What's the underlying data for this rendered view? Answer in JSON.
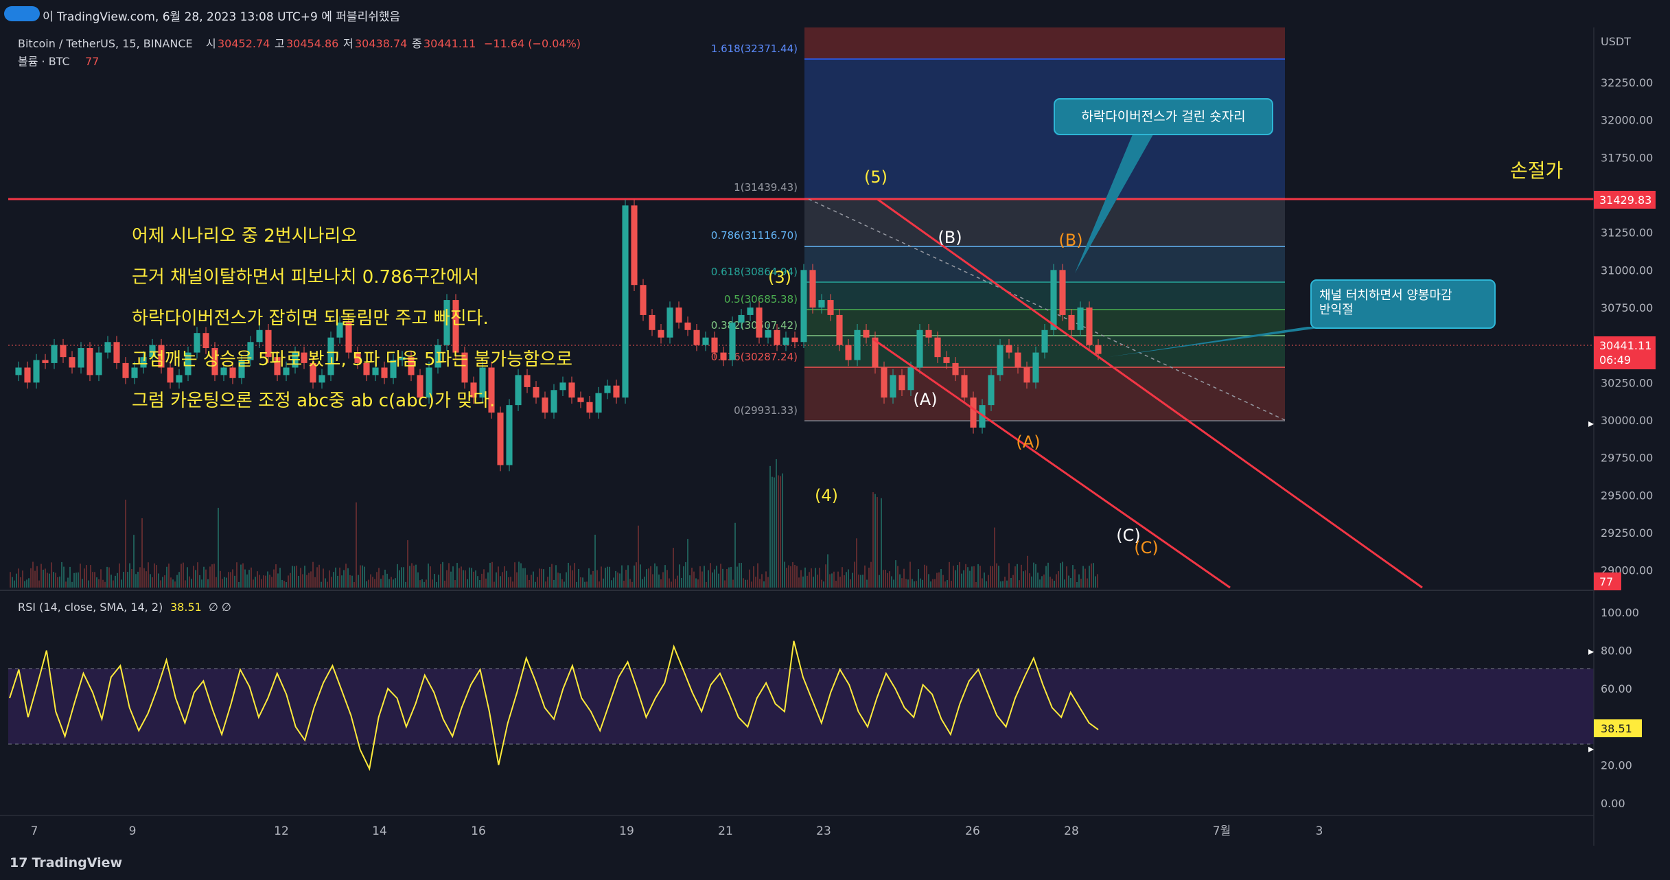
{
  "header": {
    "title_text": "이 TradingView.com, 6월 28, 2023 13:08 UTC+9 에 퍼블리쉬했음"
  },
  "symbol": {
    "name": "Bitcoin / TetherUS, 15, BINANCE",
    "o_label": "시",
    "o": "30452.74",
    "h_label": "고",
    "h": "30454.86",
    "l_label": "저",
    "l": "30438.74",
    "c_label": "종",
    "c": "30441.11",
    "change": "−11.64 (−0.04%)",
    "volume_label": "볼륨 · BTC",
    "volume_value": "77"
  },
  "colors": {
    "up": "#26a69a",
    "down": "#ef5350",
    "annotation": "#ffeb3b",
    "rsi": "#ffeb3b",
    "orange": "#f7931a",
    "callout": "#1b7f9a"
  },
  "price_axis": {
    "currency": "USDT",
    "ticks": [
      "32250.00",
      "32000.00",
      "31750.00",
      "31500.00",
      "31250.00",
      "31000.00",
      "30750.00",
      "30500.00",
      "30250.00",
      "30000.00",
      "29750.00",
      "29500.00",
      "29250.00",
      "29000.00"
    ]
  },
  "price_labels": {
    "stoploss": "31429.83",
    "last": "30441.11",
    "countdown": "06:49",
    "volume": "77"
  },
  "rsi_axis": {
    "ticks": [
      "100.00",
      "80.00",
      "60.00",
      "40.00",
      "20.00",
      "0.00"
    ],
    "value": "38.51"
  },
  "rsi_legend": {
    "label": "RSI (14, close, SMA, 14, 2)",
    "value": "38.51",
    "extra": "∅ ∅"
  },
  "time_axis": {
    "ticks": [
      "7",
      "9",
      "12",
      "14",
      "16",
      "19",
      "21",
      "23",
      "26",
      "28",
      "7월",
      "3"
    ]
  },
  "fib_labels": [
    "1.618(32371.44)",
    "1(31439.43)",
    "0.786(31116.70)",
    "0.618(30864.94)",
    "0.5(30685.38)",
    "0.382(30507.42)",
    "0.236(30287.24)",
    "0(29931.33)"
  ],
  "annotations": {
    "stoploss": "손절가",
    "note_lines": [
      "어제 시나리오 중 2번시나리오",
      "근거 채널이탈하면서 피보나치 0.786구간에서",
      "하락다이버전스가 잡히면 되돌림만 주고 빠진다.",
      "고점깨는 상승을 5파로 봤고, 5파 다음 5파는 불가능함으로",
      "그럼 카운팅으론 조정 abc중 ab c(abc)가 맞다."
    ],
    "callout1": "하락다이버전스가 걸린 숏자리",
    "callout2_lines": [
      "채널 터치하면서 양봉마감",
      "반익절"
    ],
    "waves": {
      "w3": "(3)",
      "w4": "(4)",
      "w5": "(5)",
      "A_white": "(A)",
      "B_white": "(B)",
      "C_white": "(C)",
      "A_orange": "(A)",
      "B_orange": "(B)",
      "C_orange": "(C)"
    }
  },
  "footer": {
    "logo_mark": "17",
    "logo_text": "TradingView"
  },
  "chart_data": [
    {
      "type": "line",
      "title": "Bitcoin / TetherUS, 15, BINANCE",
      "ylabel": "USDT",
      "ylim": [
        28850,
        32450
      ],
      "x_categories": [
        "7",
        "9",
        "12",
        "14",
        "16",
        "19",
        "21",
        "23",
        "26",
        "28",
        "7월",
        "3"
      ],
      "series": [
        {
          "name": "close",
          "values": [
            30300,
            30350,
            30250,
            30400,
            30380,
            30500,
            30420,
            30350,
            30480,
            30300,
            30450,
            30520,
            30380,
            30280,
            30350,
            30420,
            30500,
            30350,
            30250,
            30300,
            30450,
            30580,
            30480,
            30300,
            30350,
            30280,
            30400,
            30520,
            30600,
            30420,
            30300,
            30350,
            30450,
            30380,
            30250,
            30300,
            30550,
            30650,
            30450,
            30380,
            30300,
            30350,
            30280,
            30400,
            30420,
            30300,
            30150,
            30350,
            30500,
            30800,
            30450,
            30250,
            30150,
            30350,
            30050,
            29700,
            30100,
            30300,
            30220,
            30150,
            30050,
            30200,
            30250,
            30150,
            30120,
            30050,
            30180,
            30230,
            30150,
            31430,
            30900,
            30700,
            30600,
            30550,
            30750,
            30650,
            30600,
            30500,
            30550,
            30450,
            30400,
            30650,
            30700,
            30750,
            30550,
            30600,
            30500,
            30550,
            30520,
            31000,
            30750,
            30800,
            30700,
            30500,
            30400,
            30600,
            30550,
            30350,
            30150,
            30300,
            30200,
            30350,
            30600,
            30550,
            30420,
            30380,
            30300,
            30150,
            29950,
            30100,
            30300,
            30500,
            30450,
            30350,
            30250,
            30450,
            30600,
            31000,
            30700,
            30600,
            30750,
            30500,
            30441
          ]
        }
      ],
      "horizontal_lines": [
        {
          "label": "손절가",
          "value": 31429.83
        }
      ],
      "fibonacci": [
        {
          "level": 1.618,
          "price": 32371.44
        },
        {
          "level": 1,
          "price": 31439.43
        },
        {
          "level": 0.786,
          "price": 31116.7
        },
        {
          "level": 0.618,
          "price": 30864.94
        },
        {
          "level": 0.5,
          "price": 30685.38
        },
        {
          "level": 0.382,
          "price": 30507.42
        },
        {
          "level": 0.236,
          "price": 30287.24
        },
        {
          "level": 0,
          "price": 29931.33
        }
      ],
      "last_price": 30441.11,
      "grid": false,
      "legend": "top-left"
    },
    {
      "type": "bar",
      "title": "볼륨 · BTC",
      "last_value": 77
    },
    {
      "type": "line",
      "title": "RSI (14, close, SMA, 14, 2)",
      "ylim": [
        0,
        100
      ],
      "bands": [
        30,
        70
      ],
      "series": [
        {
          "name": "RSI",
          "values": [
            55,
            70,
            45,
            62,
            80,
            48,
            35,
            52,
            68,
            58,
            44,
            66,
            72,
            50,
            38,
            47,
            60,
            75,
            55,
            42,
            58,
            64,
            49,
            36,
            52,
            70,
            61,
            45,
            55,
            68,
            57,
            40,
            33,
            50,
            63,
            72,
            59,
            46,
            28,
            18,
            45,
            60,
            55,
            40,
            52,
            67,
            58,
            44,
            35,
            50,
            62,
            70,
            48,
            20,
            42,
            58,
            76,
            64,
            50,
            44,
            60,
            72,
            55,
            48,
            38,
            52,
            66,
            74,
            60,
            45,
            55,
            63,
            82,
            70,
            58,
            48,
            62,
            68,
            57,
            45,
            40,
            55,
            63,
            52,
            48,
            85,
            66,
            54,
            42,
            58,
            70,
            62,
            48,
            40,
            55,
            68,
            60,
            50,
            45,
            62,
            57,
            44,
            36,
            52,
            64,
            70,
            58,
            46,
            40,
            55,
            66,
            76,
            62,
            50,
            45,
            58,
            50,
            42,
            38.51
          ]
        }
      ]
    }
  ]
}
